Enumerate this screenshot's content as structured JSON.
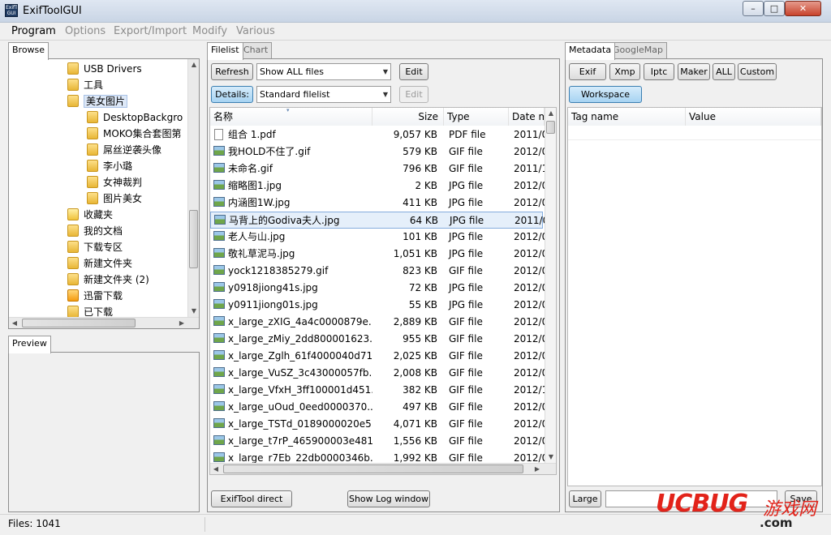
{
  "window": {
    "title": "ExifToolGUI",
    "icon_text": "ExifTool GUI",
    "controls": {
      "minimize": "–",
      "maximize": "□",
      "close": "✕"
    }
  },
  "menu": [
    "Program",
    "Options",
    "Export/Import",
    "Modify",
    "Various"
  ],
  "browse": {
    "tab": "Browse",
    "tree": [
      {
        "label": "USB Drivers",
        "icon": "folder-icon"
      },
      {
        "label": "工具",
        "icon": "folder-icon"
      },
      {
        "label": "美女图片",
        "icon": "folder-icon",
        "selected": true
      },
      {
        "label": "DesktopBackgro",
        "icon": "folder-icon"
      },
      {
        "label": "MOKO集合套图第",
        "icon": "folder-icon"
      },
      {
        "label": "屌丝逆袭头像",
        "icon": "folder-icon"
      },
      {
        "label": "李小璐",
        "icon": "folder-icon"
      },
      {
        "label": "女神裁判",
        "icon": "folder-icon"
      },
      {
        "label": "图片美女",
        "icon": "folder-icon"
      },
      {
        "label": "收藏夹",
        "icon": "star-folder-icon"
      },
      {
        "label": "我的文档",
        "icon": "folder-icon"
      },
      {
        "label": "下载专区",
        "icon": "folder-icon"
      },
      {
        "label": "新建文件夹",
        "icon": "folder-icon"
      },
      {
        "label": "新建文件夹 (2)",
        "icon": "folder-icon"
      },
      {
        "label": "迅雷下载",
        "icon": "thunder-icon"
      },
      {
        "label": "已下载",
        "icon": "folder-icon"
      }
    ],
    "preview_tab": "Preview"
  },
  "filelist": {
    "tabs": [
      "Filelist",
      "Chart"
    ],
    "refresh_label": "Refresh",
    "filter_value": "Show ALL files",
    "edit_label": "Edit",
    "details_label": "Details:",
    "view_value": "Standard filelist",
    "edit2_label": "Edit",
    "columns": [
      "名称",
      "Size",
      "Type",
      "Date m"
    ],
    "rows": [
      {
        "name": "组合 1.pdf",
        "size": "9,057 KB",
        "type": "PDF file",
        "date": "2011/0",
        "icon": "pdf"
      },
      {
        "name": "我HOLD不住了.gif",
        "size": "579 KB",
        "type": "GIF file",
        "date": "2012/0",
        "icon": "img"
      },
      {
        "name": "未命名.gif",
        "size": "796 KB",
        "type": "GIF file",
        "date": "2011/1",
        "icon": "img"
      },
      {
        "name": "缩略图1.jpg",
        "size": "2 KB",
        "type": "JPG file",
        "date": "2012/0",
        "icon": "img"
      },
      {
        "name": "内涵图1W.jpg",
        "size": "411 KB",
        "type": "JPG file",
        "date": "2012/0",
        "icon": "img"
      },
      {
        "name": "马背上的Godiva夫人.jpg",
        "size": "64 KB",
        "type": "JPG file",
        "date": "2011/0",
        "icon": "img",
        "selected": true
      },
      {
        "name": "老人与山.jpg",
        "size": "101 KB",
        "type": "JPG file",
        "date": "2012/0",
        "icon": "img"
      },
      {
        "name": "敬礼草泥马.jpg",
        "size": "1,051 KB",
        "type": "JPG file",
        "date": "2012/0",
        "icon": "img"
      },
      {
        "name": "yock1218385279.gif",
        "size": "823 KB",
        "type": "GIF file",
        "date": "2012/0",
        "icon": "img"
      },
      {
        "name": "y0918jiong41s.jpg",
        "size": "72 KB",
        "type": "JPG file",
        "date": "2012/0",
        "icon": "img"
      },
      {
        "name": "y0911jiong01s.jpg",
        "size": "55 KB",
        "type": "JPG file",
        "date": "2012/0",
        "icon": "img"
      },
      {
        "name": "x_large_zXIG_4a4c0000879e...",
        "size": "2,889 KB",
        "type": "GIF file",
        "date": "2012/0",
        "icon": "img"
      },
      {
        "name": "x_large_zMiy_2dd800001623...",
        "size": "955 KB",
        "type": "GIF file",
        "date": "2012/0",
        "icon": "img"
      },
      {
        "name": "x_large_Zglh_61f4000040d71...",
        "size": "2,025 KB",
        "type": "GIF file",
        "date": "2012/0",
        "icon": "img"
      },
      {
        "name": "x_large_VuSZ_3c43000057fb...",
        "size": "2,008 KB",
        "type": "GIF file",
        "date": "2012/0",
        "icon": "img"
      },
      {
        "name": "x_large_VfxH_3ff100001d451...",
        "size": "382 KB",
        "type": "GIF file",
        "date": "2012/1",
        "icon": "img"
      },
      {
        "name": "x_large_uOud_0eed0000370...",
        "size": "497 KB",
        "type": "GIF file",
        "date": "2012/0",
        "icon": "img"
      },
      {
        "name": "x_large_TSTd_0189000020e5...",
        "size": "4,071 KB",
        "type": "GIF file",
        "date": "2012/0",
        "icon": "img"
      },
      {
        "name": "x_large_t7rP_465900003e481...",
        "size": "1,556 KB",
        "type": "GIF file",
        "date": "2012/0",
        "icon": "img"
      },
      {
        "name": "x_large_r7Eb_22db0000346b...",
        "size": "1,992 KB",
        "type": "GIF file",
        "date": "2012/0",
        "icon": "img"
      }
    ],
    "exiftool_direct_label": "ExifTool direct",
    "show_log_label": "Show Log window"
  },
  "metadata": {
    "tabs": [
      "Metadata",
      "GoogleMap"
    ],
    "buttons": [
      "Exif",
      "Xmp",
      "Iptc",
      "Maker",
      "ALL",
      "Custom"
    ],
    "workspace_label": "Workspace",
    "columns": [
      "Tag name",
      "Value"
    ],
    "large_label": "Large",
    "save_label": "Save"
  },
  "status": {
    "files": "Files: 1041"
  },
  "watermark": {
    "main": "UCBUG",
    "cn": "游戏网",
    "com": ".com"
  }
}
